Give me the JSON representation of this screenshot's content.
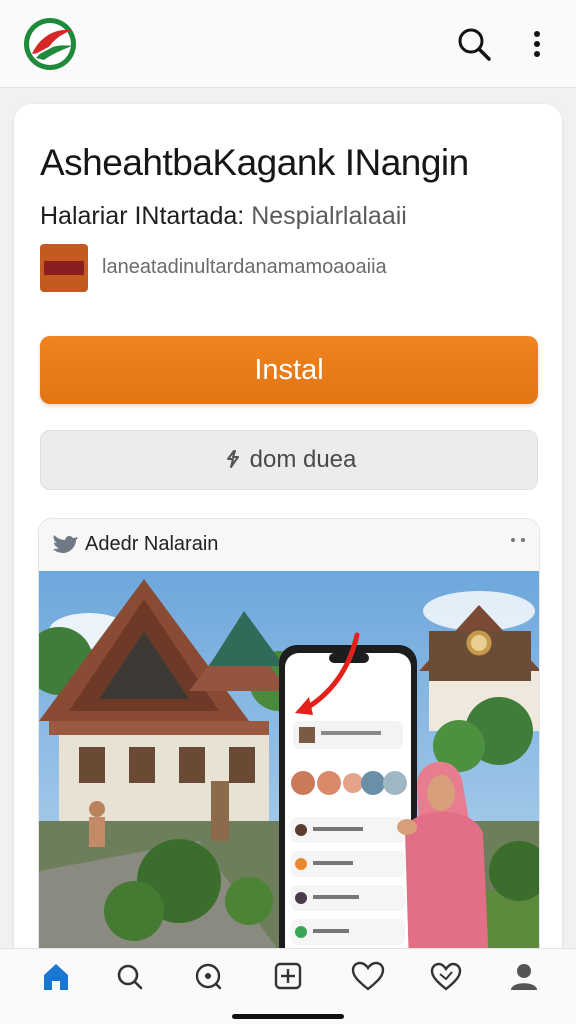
{
  "header": {
    "logo_icon": "leaf-logo-icon",
    "search_icon": "search-icon",
    "more_icon": "more-vertical-icon"
  },
  "app": {
    "title": "AsheahtbaKagank INangin",
    "subtitle_left": "Halariar INtartada:",
    "subtitle_right": "Nespialrlalaaii",
    "developer_text": "laneatadinultardanamamoaoaiia",
    "install_label": "Instal",
    "secondary_label": "dom duea"
  },
  "media": {
    "title": "Adedr Nalarain",
    "icon": "bird-icon"
  },
  "nav": {
    "items": [
      "home-icon",
      "search-icon",
      "explore-icon",
      "add-icon",
      "favorites-icon",
      "likes-icon",
      "profile-icon"
    ],
    "active_color": "#1976d2"
  },
  "colors": {
    "accent": "#e97b18",
    "logo_red": "#d62828",
    "logo_green": "#1f8a3a"
  }
}
